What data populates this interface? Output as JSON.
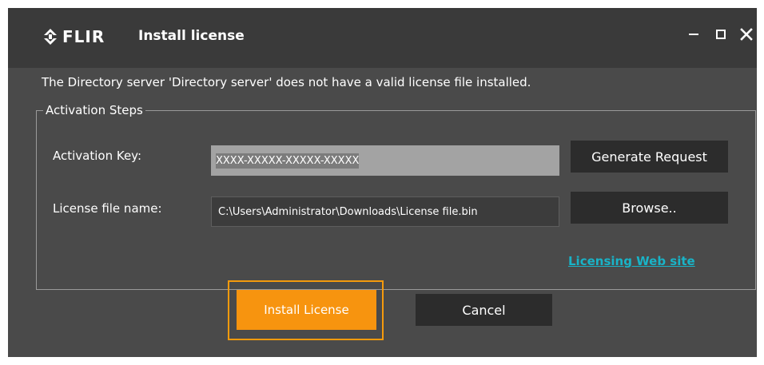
{
  "window": {
    "brand": "FLIR",
    "title": "Install license",
    "controls": [
      "minimize-icon",
      "maximize-icon",
      "close-icon"
    ]
  },
  "message": "The Directory server 'Directory server' does not have a valid license file installed.",
  "activation": {
    "group_title": "Activation Steps",
    "key_label": "Activation Key:",
    "key_value": "XXXX-XXXXX-XXXXX-XXXXX",
    "file_label": "License file name:",
    "file_value": "C:\\Users\\Administrator\\Downloads\\License file.bin",
    "generate_label": "Generate Request",
    "browse_label": "Browse..",
    "link_label": "Licensing Web site"
  },
  "actions": {
    "install_label": "Install License",
    "cancel_label": "Cancel"
  },
  "colors": {
    "accent": "#f7940f",
    "link": "#19b3c7",
    "window_bg": "#4a4a4a",
    "titlebar_bg": "#3a3a3a"
  }
}
